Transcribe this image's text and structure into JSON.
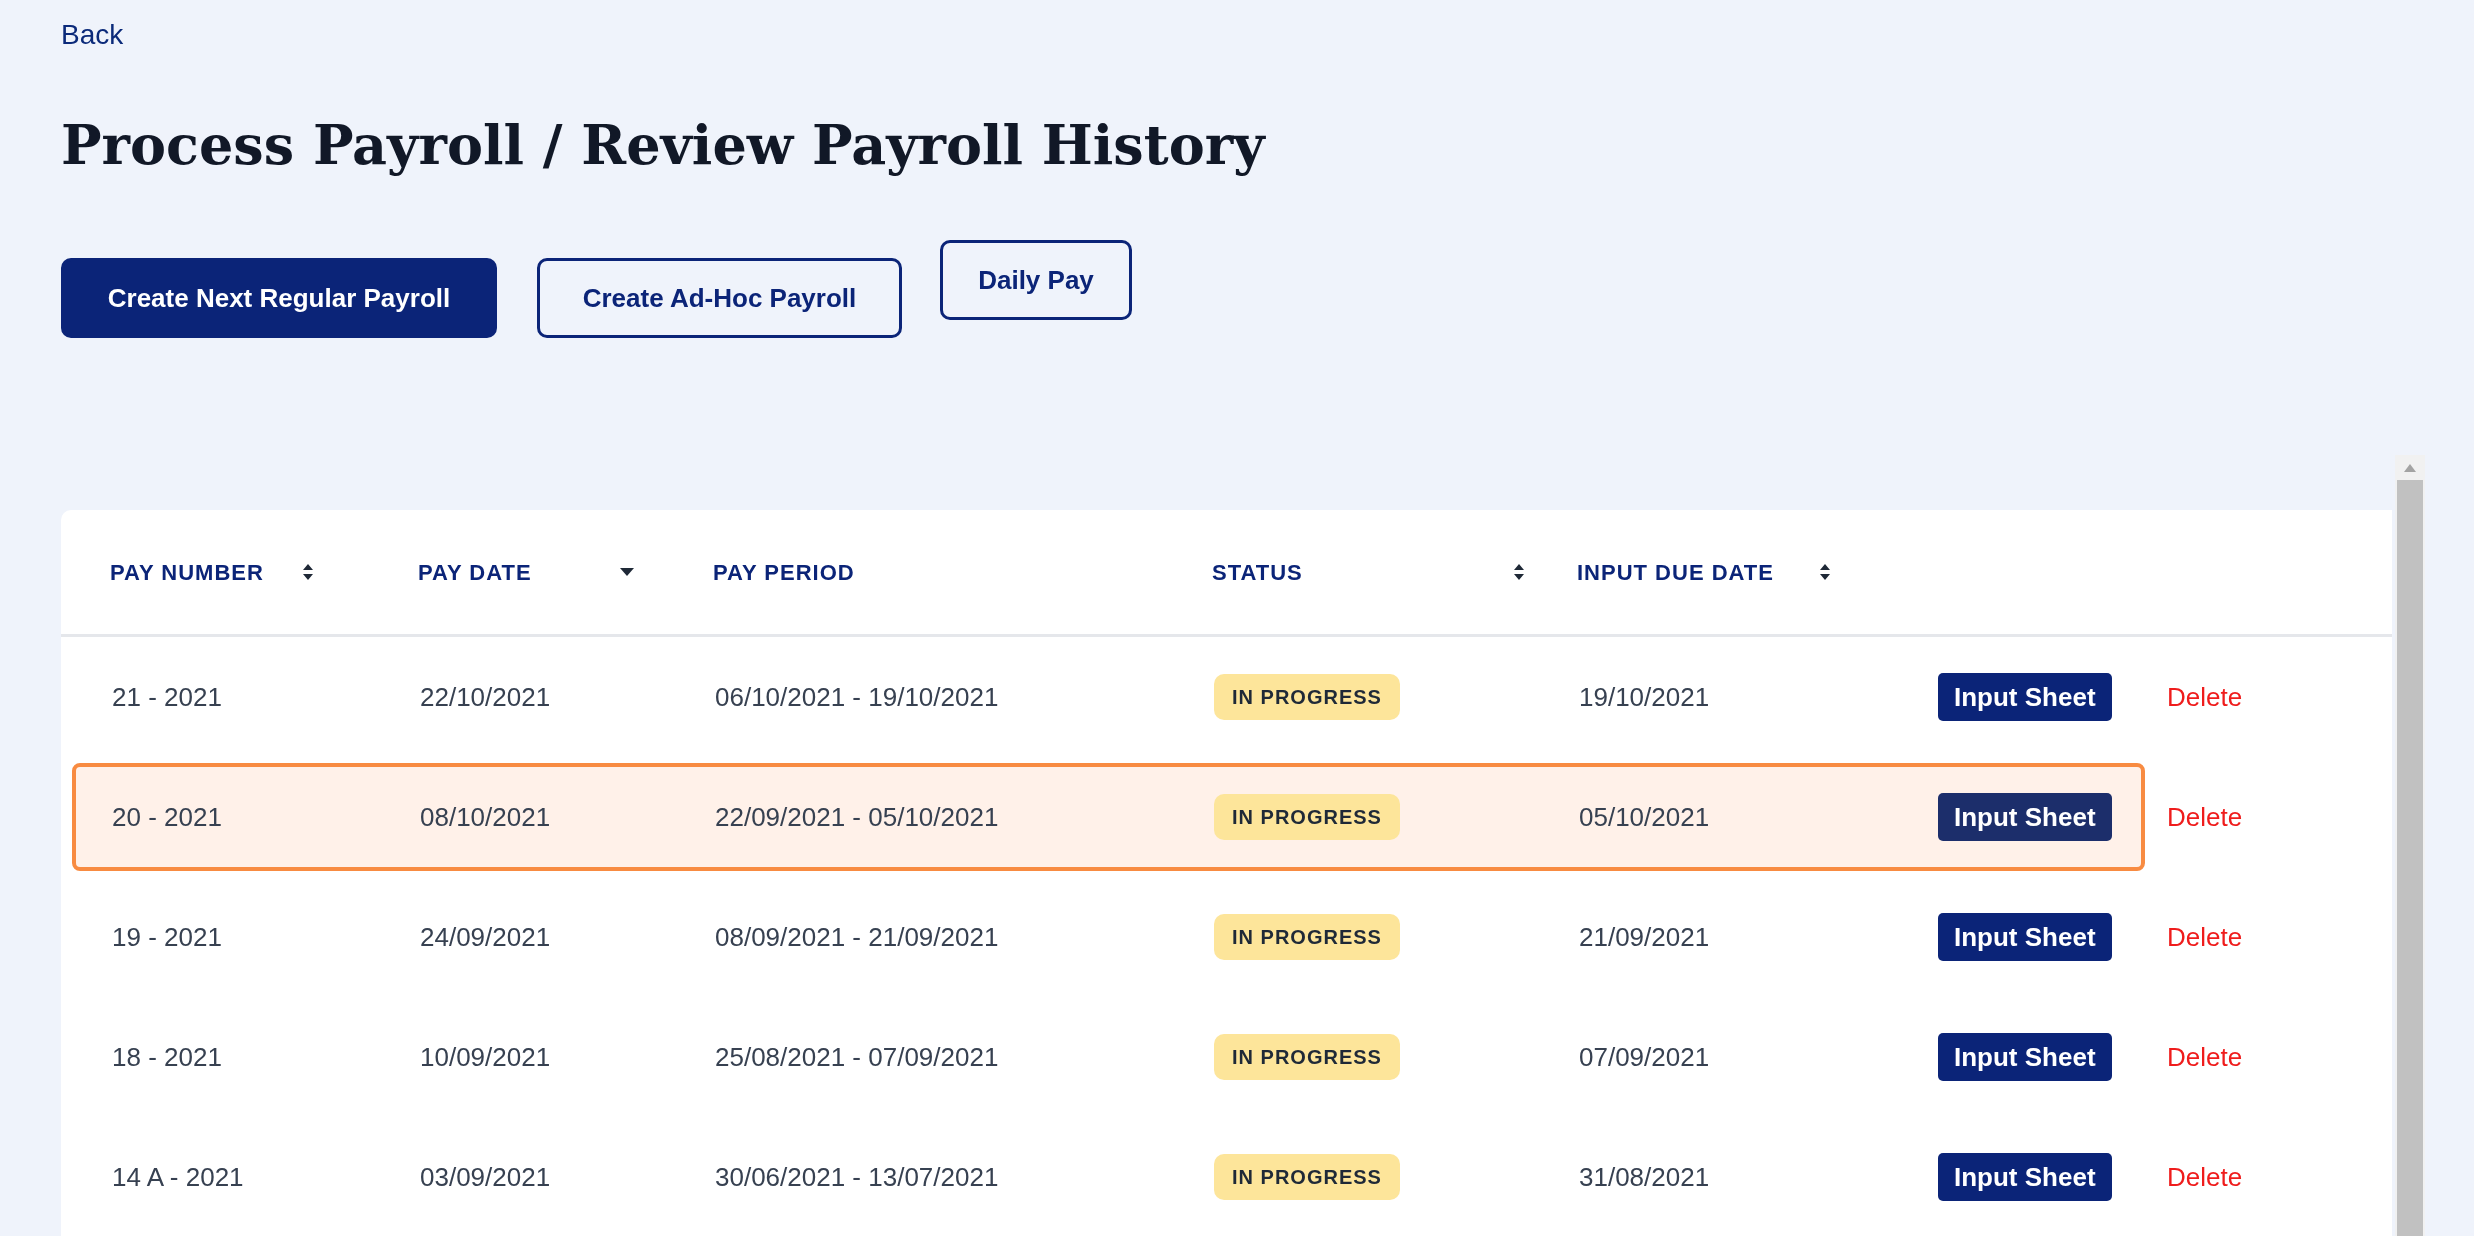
{
  "back_link": "Back",
  "title": "Process Payroll / Review Payroll History",
  "actions": [
    {
      "label": "Create Next Regular Payroll",
      "kind": "primary"
    },
    {
      "label": "Create Ad-Hoc Payroll",
      "kind": "outline"
    },
    {
      "label": "Daily Pay",
      "kind": "outline"
    }
  ],
  "table": {
    "columns": [
      {
        "label": "PAY NUMBER",
        "sorted": false
      },
      {
        "label": "PAY DATE",
        "sorted": true
      },
      {
        "label": "PAY PERIOD"
      },
      {
        "label": "STATUS",
        "sorted": false
      },
      {
        "label": "INPUT DUE DATE",
        "sorted": false
      }
    ],
    "rows": [
      {
        "pay_number": "21 - 2021",
        "pay_date": "22/10/2021",
        "pay_period": "06/10/2021 - 19/10/2021",
        "status": "IN PROGRESS",
        "input_due_date": "19/10/2021",
        "action": "Input Sheet",
        "delete": "Delete",
        "highlighted": false
      },
      {
        "pay_number": "20 - 2021",
        "pay_date": "08/10/2021",
        "pay_period": "22/09/2021 - 05/10/2021",
        "status": "IN PROGRESS",
        "input_due_date": "05/10/2021",
        "action": "Input Sheet",
        "delete": "Delete",
        "highlighted": true
      },
      {
        "pay_number": "19 - 2021",
        "pay_date": "24/09/2021",
        "pay_period": "08/09/2021 - 21/09/2021",
        "status": "IN PROGRESS",
        "input_due_date": "21/09/2021",
        "action": "Input Sheet",
        "delete": "Delete",
        "highlighted": false
      },
      {
        "pay_number": "18 - 2021",
        "pay_date": "10/09/2021",
        "pay_period": "25/08/2021 - 07/09/2021",
        "status": "IN PROGRESS",
        "input_due_date": "07/09/2021",
        "action": "Input Sheet",
        "delete": "Delete",
        "highlighted": false
      },
      {
        "pay_number": "14 A - 2021",
        "pay_date": "03/09/2021",
        "pay_period": "30/06/2021 - 13/07/2021",
        "status": "IN PROGRESS",
        "input_due_date": "31/08/2021",
        "action": "Input Sheet",
        "delete": "Delete",
        "highlighted": false
      }
    ]
  }
}
